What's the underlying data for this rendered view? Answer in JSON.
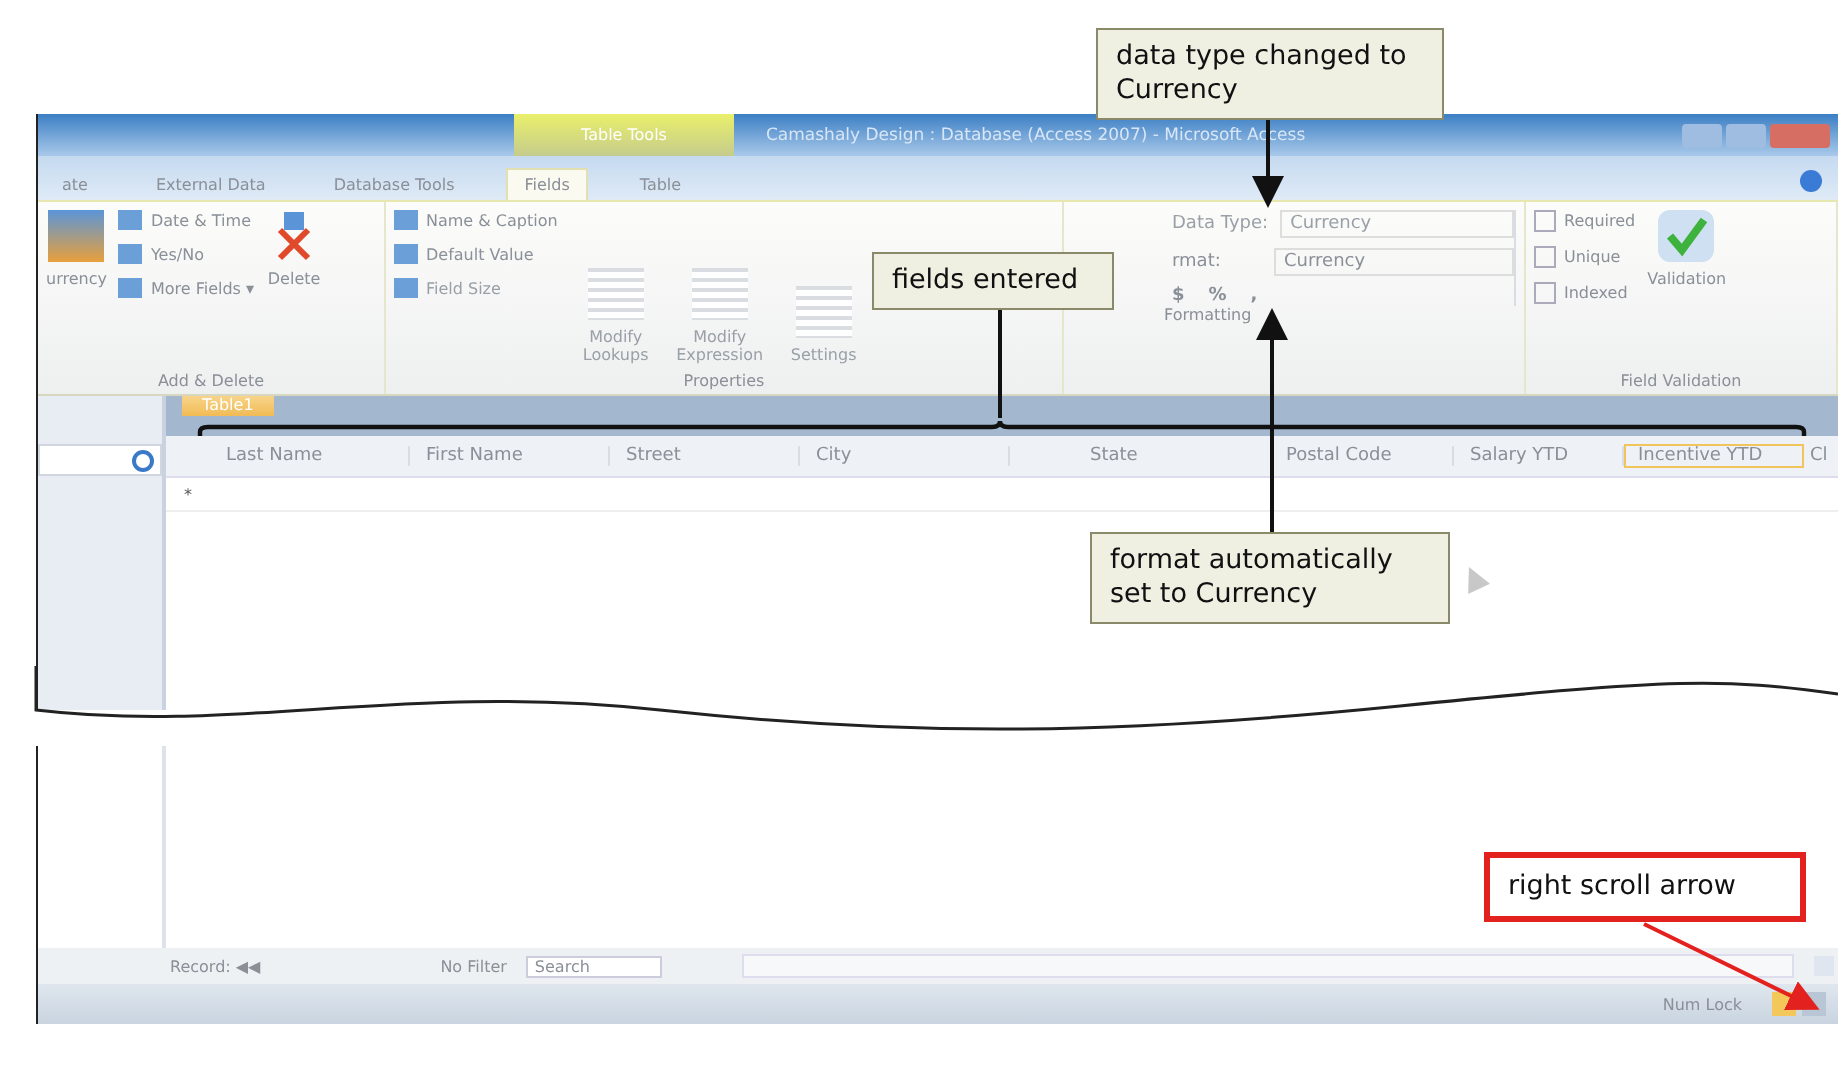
{
  "title_bar": {
    "context_tab": "Table Tools",
    "title": "Camashaly Design : Database (Access 2007) - Microsoft Access"
  },
  "ribbon_tabs": [
    {
      "label": "ate",
      "selected": false
    },
    {
      "label": "External Data",
      "selected": false
    },
    {
      "label": "Database Tools",
      "selected": false
    },
    {
      "label": "Fields",
      "selected": true
    },
    {
      "label": "Table",
      "selected": false
    }
  ],
  "add_delete": {
    "label": "Add & Delete",
    "big": "urrency",
    "small": [
      "Date & Time",
      "Yes/No",
      "More Fields ▾"
    ],
    "delete": "Delete"
  },
  "properties": {
    "label": "Properties",
    "small": [
      {
        "label": "Name & Caption",
        "disabled": false
      },
      {
        "label": "Default Value",
        "disabled": false
      },
      {
        "label": "Field Size",
        "disabled": true
      }
    ],
    "big": [
      "Modify Lookups",
      "Modify Expression",
      "Settings"
    ]
  },
  "formatting": {
    "label": "Formatting",
    "data_type_label": "Data Type:",
    "data_type": "Currency",
    "format_label": "rmat:",
    "format": "Currency",
    "number_buttons": [
      "$",
      "%",
      ","
    ]
  },
  "field_validation": {
    "label": "Field Validation",
    "checks": [
      {
        "label": "Required",
        "checked": false
      },
      {
        "label": "Unique",
        "checked": false
      },
      {
        "label": "Indexed",
        "checked": false
      }
    ],
    "validation": "Validation"
  },
  "table": {
    "tab": "Table1",
    "columns": [
      {
        "label": "Last Name",
        "selected": false
      },
      {
        "label": "First Name",
        "selected": false
      },
      {
        "label": "Street",
        "selected": false
      },
      {
        "label": "City",
        "selected": false
      },
      {
        "label": "State",
        "selected": false
      },
      {
        "label": "Postal Code",
        "selected": false
      },
      {
        "label": "Salary YTD",
        "selected": false
      },
      {
        "label": "Incentive YTD",
        "selected": true
      },
      {
        "label": "Cl",
        "selected": false
      }
    ],
    "new_row_marker": "*"
  },
  "nav_bar": {
    "record_label": "Record: ◀◀",
    "filter": "No Filter",
    "search": "Search"
  },
  "status_bar": {
    "num_lock": "Num Lock"
  },
  "callouts": [
    {
      "text": "data type changed to Currency",
      "kind": "note"
    },
    {
      "text": "fields entered",
      "kind": "note"
    },
    {
      "text": "format automatically set to Currency",
      "kind": "note"
    },
    {
      "text": "right scroll arrow",
      "kind": "highlight"
    }
  ]
}
